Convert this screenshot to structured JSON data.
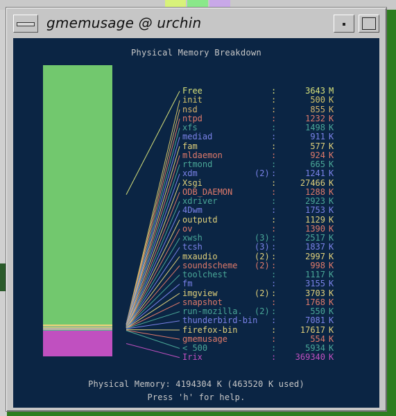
{
  "window": {
    "title": "gmemusage @ urchin"
  },
  "chart": {
    "title": "Physical Memory Breakdown",
    "total_line": "Physical Memory: 4194304 K (463520 K used)",
    "help_line": "Press 'h' for help."
  },
  "processes": [
    {
      "name": "Free",
      "count": "",
      "value": "3643",
      "unit": "M",
      "color": "#d8e27a"
    },
    {
      "name": "init",
      "count": "",
      "value": "500",
      "unit": "K",
      "color": "#d4c46a"
    },
    {
      "name": "nsd",
      "count": "",
      "value": "855",
      "unit": "K",
      "color": "#d8b56a"
    },
    {
      "name": "ntpd",
      "count": "",
      "value": "1232",
      "unit": "K",
      "color": "#e07a6a"
    },
    {
      "name": "xfs",
      "count": "",
      "value": "1498",
      "unit": "K",
      "color": "#4aa898"
    },
    {
      "name": "mediad",
      "count": "",
      "value": "911",
      "unit": "K",
      "color": "#7a82e8"
    },
    {
      "name": "fam",
      "count": "",
      "value": "577",
      "unit": "K",
      "color": "#e0d07a"
    },
    {
      "name": "mldaemon",
      "count": "",
      "value": "924",
      "unit": "K",
      "color": "#e07a6a"
    },
    {
      "name": "rtmond",
      "count": "",
      "value": "665",
      "unit": "K",
      "color": "#4aa898"
    },
    {
      "name": "xdm",
      "count": "(2)",
      "value": "1241",
      "unit": "K",
      "color": "#7a82e8"
    },
    {
      "name": "Xsgi",
      "count": "",
      "value": "27466",
      "unit": "K",
      "color": "#e0d07a"
    },
    {
      "name": "ODB_DAEMON",
      "count": "",
      "value": "1288",
      "unit": "K",
      "color": "#e07a6a"
    },
    {
      "name": "xdriver",
      "count": "",
      "value": "2923",
      "unit": "K",
      "color": "#4aa898"
    },
    {
      "name": "4Dwm",
      "count": "",
      "value": "1753",
      "unit": "K",
      "color": "#7a82e8"
    },
    {
      "name": "outputd",
      "count": "",
      "value": "1129",
      "unit": "K",
      "color": "#e0d07a"
    },
    {
      "name": "ov",
      "count": "",
      "value": "1390",
      "unit": "K",
      "color": "#e07a6a"
    },
    {
      "name": "xwsh",
      "count": "(3)",
      "value": "2517",
      "unit": "K",
      "color": "#4aa898"
    },
    {
      "name": "tcsh",
      "count": "(3)",
      "value": "1837",
      "unit": "K",
      "color": "#7a82e8"
    },
    {
      "name": "mxaudio",
      "count": "(2)",
      "value": "2997",
      "unit": "K",
      "color": "#e0d07a"
    },
    {
      "name": "soundscheme",
      "count": "(2)",
      "value": "998",
      "unit": "K",
      "color": "#e07a6a"
    },
    {
      "name": "toolchest",
      "count": "",
      "value": "1117",
      "unit": "K",
      "color": "#4aa898"
    },
    {
      "name": "fm",
      "count": "",
      "value": "3155",
      "unit": "K",
      "color": "#7a82e8"
    },
    {
      "name": "imgview",
      "count": "(2)",
      "value": "3703",
      "unit": "K",
      "color": "#e0d07a"
    },
    {
      "name": "snapshot",
      "count": "",
      "value": "1768",
      "unit": "K",
      "color": "#e07a6a"
    },
    {
      "name": "run-mozilla.",
      "count": "(2)",
      "value": "550",
      "unit": "K",
      "color": "#4aa898"
    },
    {
      "name": "thunderbird-bin",
      "count": "",
      "value": "7081",
      "unit": "K",
      "color": "#7a82e8"
    },
    {
      "name": "firefox-bin",
      "count": "",
      "value": "17617",
      "unit": "K",
      "color": "#e0d07a"
    },
    {
      "name": "gmemusage",
      "count": "",
      "value": "554",
      "unit": "K",
      "color": "#e07a6a"
    },
    {
      "name": "< 500",
      "count": "",
      "value": "5934",
      "unit": "K",
      "color": "#4aa898"
    },
    {
      "name": "Irix",
      "count": "",
      "value": "369340",
      "unit": "K",
      "color": "#c050c0"
    }
  ]
}
